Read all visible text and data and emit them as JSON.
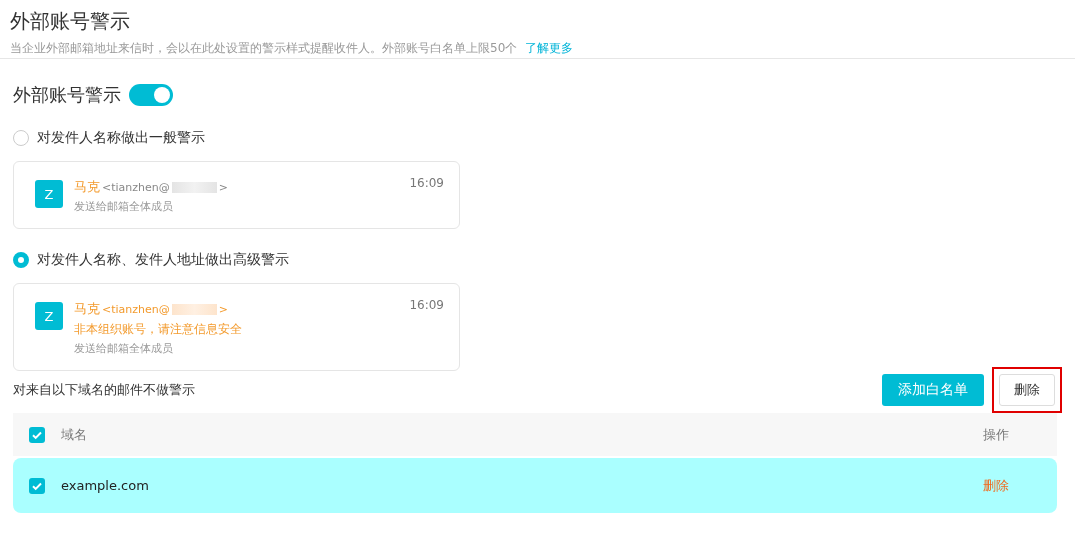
{
  "page": {
    "title": "外部账号警示",
    "description": "当企业外部邮箱地址来信时，会以在此处设置的警示样式提醒收件人。外部账号白名单上限50个",
    "learn_more": "了解更多"
  },
  "toggle": {
    "label": "外部账号警示",
    "on": true
  },
  "options": [
    {
      "label": "对发件人名称做出一般警示",
      "selected": false,
      "preview": {
        "kind": "basic",
        "avatar": "Z",
        "sender": "马克",
        "address_start": "<tianzhen@",
        "address_end": ">",
        "time": "16:09",
        "recipients": "发送给邮箱全体成员"
      }
    },
    {
      "label": "对发件人名称、发件人地址做出高级警示",
      "selected": true,
      "preview": {
        "kind": "advanced",
        "avatar": "Z",
        "sender": "马克",
        "address_start": "<tianzhen@",
        "address_end": ">",
        "time": "16:09",
        "warning": "非本组织账号，请注意信息安全",
        "recipients": "发送给邮箱全体成员"
      }
    }
  ],
  "whitelist": {
    "caption": "对来自以下域名的邮件不做警示",
    "add_button": "添加白名单",
    "delete_button": {
      "label": "删除",
      "highlighted": true
    },
    "table": {
      "columns": [
        "域名",
        "操作"
      ],
      "all_checked": true,
      "rows": [
        {
          "domain": "example.com",
          "checked": true,
          "selected": true,
          "action": "删除"
        }
      ]
    }
  }
}
